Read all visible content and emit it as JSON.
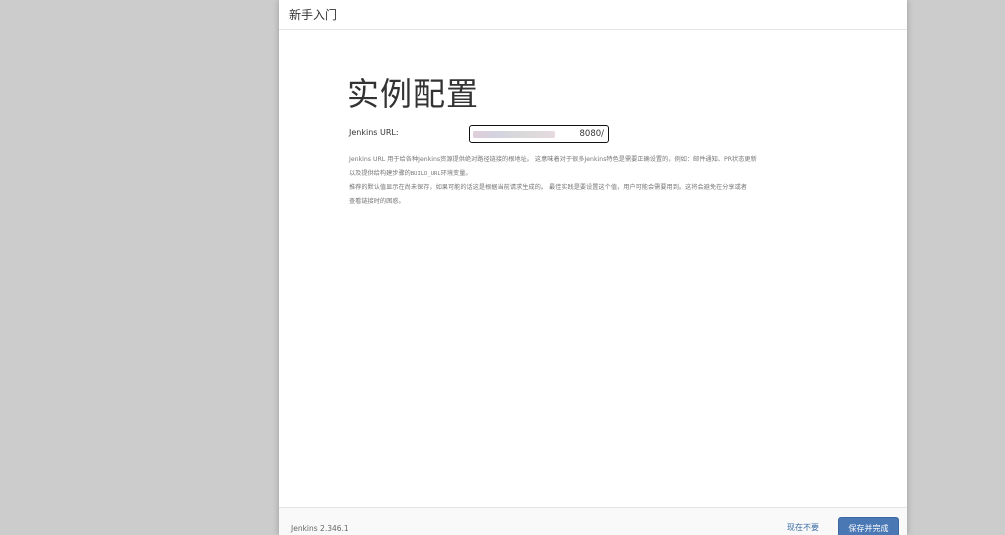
{
  "dialog": {
    "header_title": "新手入门"
  },
  "main": {
    "heading": "实例配置",
    "url_label": "Jenkins URL:",
    "url_value": "8080/",
    "help_line1": "Jenkins URL 用于给各种Jenkins资源提供绝对路径链接的根地址。 这意味着对于很多Jenkins特色是需要正确设置的，例如：邮件通知、PR状态更新",
    "help_line2_prefix": "以及提供给构建步骤的",
    "help_line2_code": "BUILD_URL",
    "help_line2_suffix": "环境变量。",
    "help_line3": "推荐的默认值显示在尚未保存，如果可能的话这是根据当前请求生成的。 最佳实践是要设置这个值，用户可能会需要用到。这将会避免在分享或者",
    "help_line4": "查看链接时的困惑。"
  },
  "footer": {
    "version": "Jenkins 2.346.1",
    "skip_label": "现在不要",
    "save_label": "保存并完成"
  },
  "colors": {
    "background": "#cccccc",
    "primary_button": "#4a78b5",
    "link": "#3b6ea5"
  }
}
